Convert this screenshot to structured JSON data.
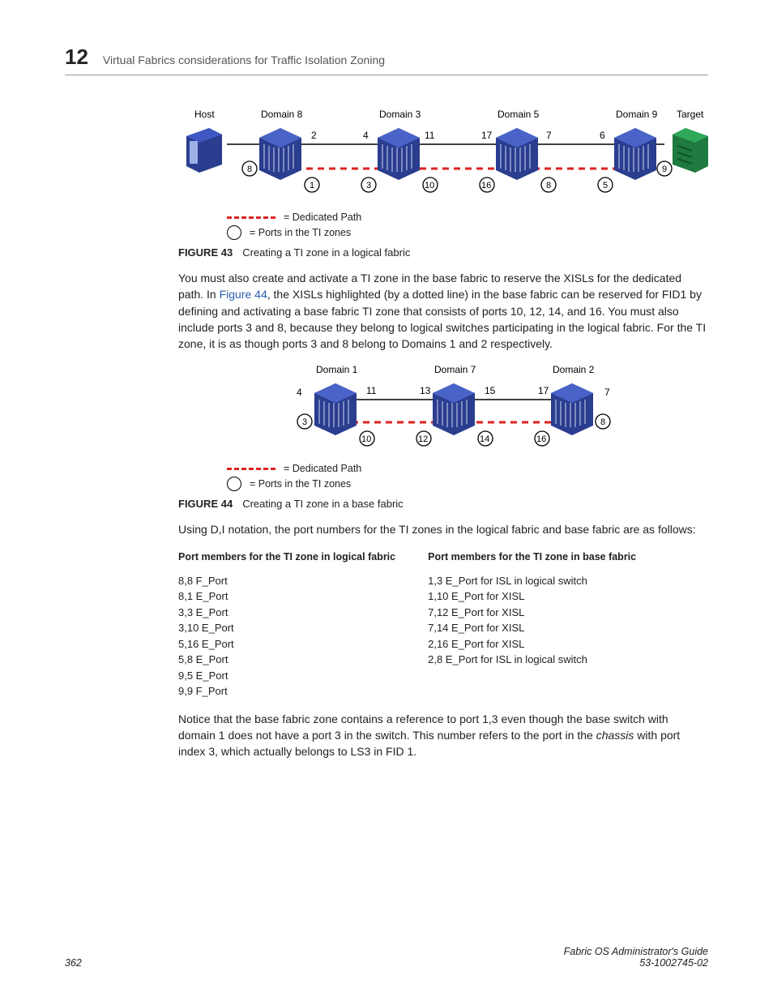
{
  "chapter_number": "12",
  "chapter_title": "Virtual Fabrics considerations for Traffic Isolation Zoning",
  "fig43": {
    "host_label": "Host",
    "target_label": "Target",
    "domains": [
      "Domain 8",
      "Domain 3",
      "Domain 5",
      "Domain 9"
    ],
    "top_ports": [
      "2",
      "4",
      "11",
      "17",
      "7",
      "6"
    ],
    "side_left": "8",
    "side_right": "9",
    "bottom_ports": [
      "1",
      "3",
      "10",
      "16",
      "8",
      "5"
    ],
    "legend_dedicated": "= Dedicated Path",
    "legend_ports": "= Ports in the TI zones",
    "caption_label": "FIGURE 43",
    "caption_text": "Creating a TI zone in a logical fabric"
  },
  "para1_a": "You must also create and activate a TI zone in the base fabric to reserve the XISLs for the dedicated path. In ",
  "para1_link": "Figure 44",
  "para1_b": ", the XISLs highlighted (by a dotted line) in the base fabric can be reserved for FID1 by defining and activating a base fabric TI zone that consists of ports 10, 12, 14, and 16. You must also include ports 3 and 8, because they belong to logical switches participating in the logical fabric. For the TI zone, it is as though ports 3 and 8 belong to Domains 1 and 2 respectively.",
  "fig44": {
    "domains": [
      "Domain 1",
      "Domain 7",
      "Domain 2"
    ],
    "left_outer": "4",
    "right_outer": "7",
    "top_ports": [
      "11",
      "13",
      "15",
      "17"
    ],
    "side_left": "3",
    "side_right": "8",
    "bottom_ports": [
      "10",
      "12",
      "14",
      "16"
    ],
    "legend_dedicated": "= Dedicated Path",
    "legend_ports": "= Ports in the TI zones",
    "caption_label": "FIGURE 44",
    "caption_text": "Creating a TI zone in a base fabric"
  },
  "para2": "Using D,I notation, the port numbers for the TI zones in the logical fabric and base fabric are as follows:",
  "table": {
    "headers": [
      "Port members for the TI zone in logical fabric",
      "Port members for the TI zone in base fabric"
    ],
    "col1": [
      "8,8 F_Port",
      "8,1 E_Port",
      "3,3 E_Port",
      "3,10 E_Port",
      "5,16 E_Port",
      "5,8 E_Port",
      "9,5 E_Port",
      "9,9 F_Port"
    ],
    "col2": [
      "1,3 E_Port for ISL in logical switch",
      "1,10 E_Port for XISL",
      "7,12 E_Port for XISL",
      "7,14 E_Port for XISL",
      "2,16 E_Port for XISL",
      "2,8 E_Port for ISL in logical switch"
    ]
  },
  "para3_a": "Notice that the base fabric zone contains a reference to port 1,3 even though the base switch with domain 1 does not have a port 3 in the switch. This number refers to the port in the ",
  "para3_em": "chassis",
  "para3_b": " with port index 3, which actually belongs to LS3 in FID 1.",
  "footer": {
    "page": "362",
    "title": "Fabric OS Administrator's Guide",
    "docnum": "53-1002745-02"
  }
}
